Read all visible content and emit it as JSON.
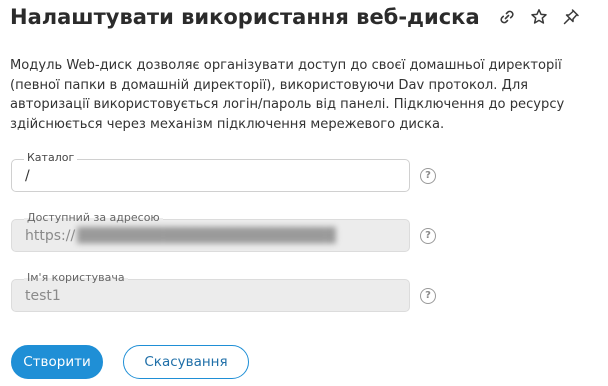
{
  "header": {
    "title": "Налаштувати використання веб-диска",
    "icons": [
      "link-icon",
      "star-icon",
      "pin-icon"
    ]
  },
  "description": "Модуль Web-диск дозволяє організувати доступ до своєї домашньої директорії (певної папки в домашній директорії), використовуючи Dav протокол. Для авторизації використовується логін/пароль від панелі. Підключення до ресурсу здійснюється через механізм підключення мережевого диска.",
  "form": {
    "catalog": {
      "label": "Каталог",
      "value": "/"
    },
    "address": {
      "label": "Доступний за адресою",
      "value": "https://"
    },
    "username": {
      "label": "Ім'я користувача",
      "value": "test1"
    },
    "help_glyph": "?"
  },
  "buttons": {
    "create_label": "Створити",
    "cancel_label": "Скасування"
  },
  "colors": {
    "accent": "#1f8fd6",
    "disabled_bg": "#ececec"
  }
}
